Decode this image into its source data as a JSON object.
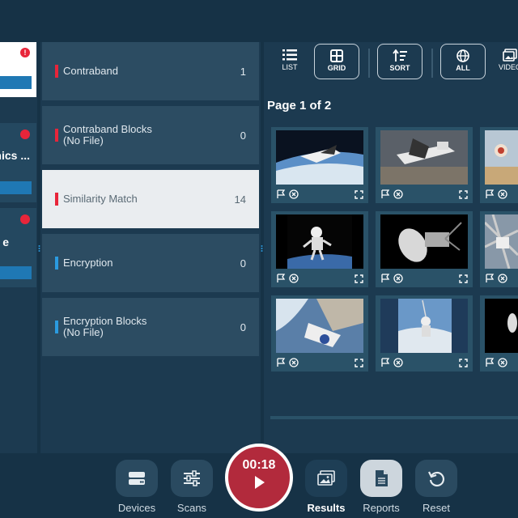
{
  "devices": [
    {
      "badge": "!",
      "title": ""
    },
    {
      "title": "nics ..."
    },
    {
      "title": "e"
    }
  ],
  "categories": [
    {
      "line1": "Contraband",
      "line2": "",
      "count": "1",
      "color": "#e8253a",
      "active": false
    },
    {
      "line1": "Contraband Blocks",
      "line2": "(No File)",
      "count": "0",
      "color": "#e8253a",
      "active": false
    },
    {
      "line1": "Similarity Match",
      "line2": "",
      "count": "14",
      "color": "#e8253a",
      "active": true
    },
    {
      "line1": "Encryption",
      "line2": "",
      "count": "0",
      "color": "#2b9be0",
      "active": false
    },
    {
      "line1": "Encryption Blocks",
      "line2": "(No File)",
      "count": "0",
      "color": "#2b9be0",
      "active": false
    }
  ],
  "toolbar": {
    "list": "LIST",
    "grid": "GRID",
    "sort": "SORT",
    "all": "ALL",
    "video": "VIDEO"
  },
  "page_label": "Page 1 of 2",
  "nav": {
    "devices": "Devices",
    "scans": "Scans",
    "timer": "00:18",
    "results": "Results",
    "reports": "Reports",
    "reset": "Reset"
  },
  "colors": {
    "accent_red": "#e8253a",
    "accent_blue": "#2b9be0",
    "timer": "#b22a3c"
  }
}
